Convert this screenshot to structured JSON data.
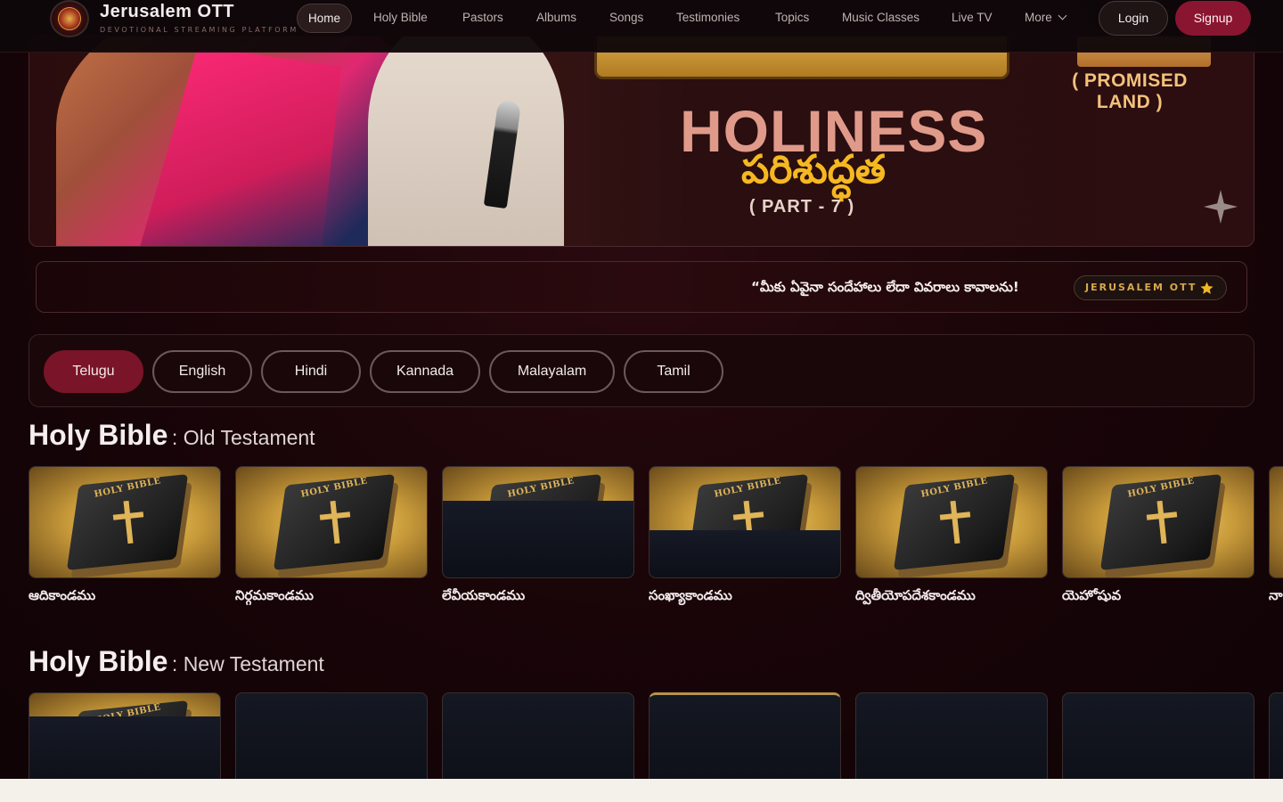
{
  "brand": {
    "title": "Jerusalem OTT",
    "subtitle": "DEVOTIONAL STREAMING PLATFORM"
  },
  "nav": {
    "links": [
      {
        "label": "Home",
        "active": true
      },
      {
        "label": "Holy Bible"
      },
      {
        "label": "Pastors"
      },
      {
        "label": "Albums"
      },
      {
        "label": "Songs"
      },
      {
        "label": "Testimonies"
      },
      {
        "label": "Topics"
      },
      {
        "label": "Music Classes"
      },
      {
        "label": "Live TV"
      },
      {
        "label": "More"
      }
    ],
    "login": "Login",
    "signup": "Signup"
  },
  "hero": {
    "service_label": "( PROMISED LAND )",
    "title": "HOLINESS",
    "telugu_title": "పరిశుద్ధత",
    "part": "( PART - 7 )"
  },
  "ticker": {
    "message": "“మీకు ఏవైనా సందేహాలు లేదా వివరాలు కావాలను!",
    "badge": "JERUSALEM OTT"
  },
  "languages": {
    "selected": "Telugu",
    "items": [
      "Telugu",
      "English",
      "Hindi",
      "Kannada",
      "Malayalam",
      "Tamil"
    ]
  },
  "sections": {
    "old": {
      "title": "Holy Bible",
      "subtitle": ": Old Testament",
      "items": [
        "ఆదికాండము",
        "నిర్గమకాండము",
        "లేవీయకాండము",
        "సంఖ్యాకాండము",
        "ద్వితీయోపదేశకాండము",
        "యెహోషువ",
        "నా"
      ]
    },
    "new": {
      "title": "Holy Bible",
      "subtitle": ": New Testament"
    }
  },
  "book_cover_text": "HOLY BIBLE",
  "colors": {
    "accent": "#8a1530",
    "gold": "#d8a84a",
    "background": "#1a0508"
  }
}
